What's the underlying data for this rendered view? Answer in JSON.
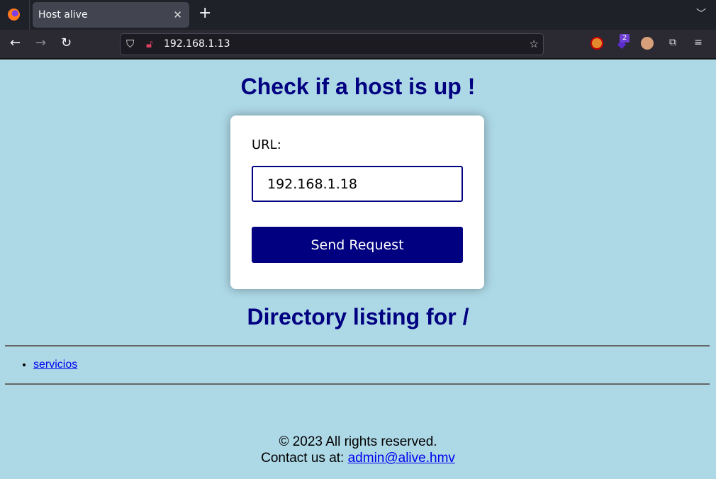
{
  "browser": {
    "tab_title": "Host alive",
    "url": "192.168.1.13",
    "extension_badge": "2",
    "icons": [
      "firefox-logo",
      "close-tab",
      "new-tab",
      "tab-list",
      "back",
      "forward",
      "reload",
      "shield",
      "insecure-lock",
      "bookmark-star",
      "extension-blocker",
      "extension-stack",
      "extension-avatar",
      "extensions-puzzle",
      "menu-hamburger"
    ]
  },
  "page": {
    "title": "Check if a host is up !",
    "form": {
      "label": "URL:",
      "input_value": "192.168.1.18",
      "button_label": "Send Request"
    },
    "listing_title": "Directory listing for /",
    "listing": [
      {
        "label": "servicios"
      }
    ],
    "footer": {
      "copyright": "© 2023 All rights reserved.",
      "contact_prefix": "Contact us at: ",
      "email": "admin@alive.hmv"
    }
  },
  "colors": {
    "background": "#add8e6",
    "accent": "#000080",
    "link": "#0000ee"
  }
}
